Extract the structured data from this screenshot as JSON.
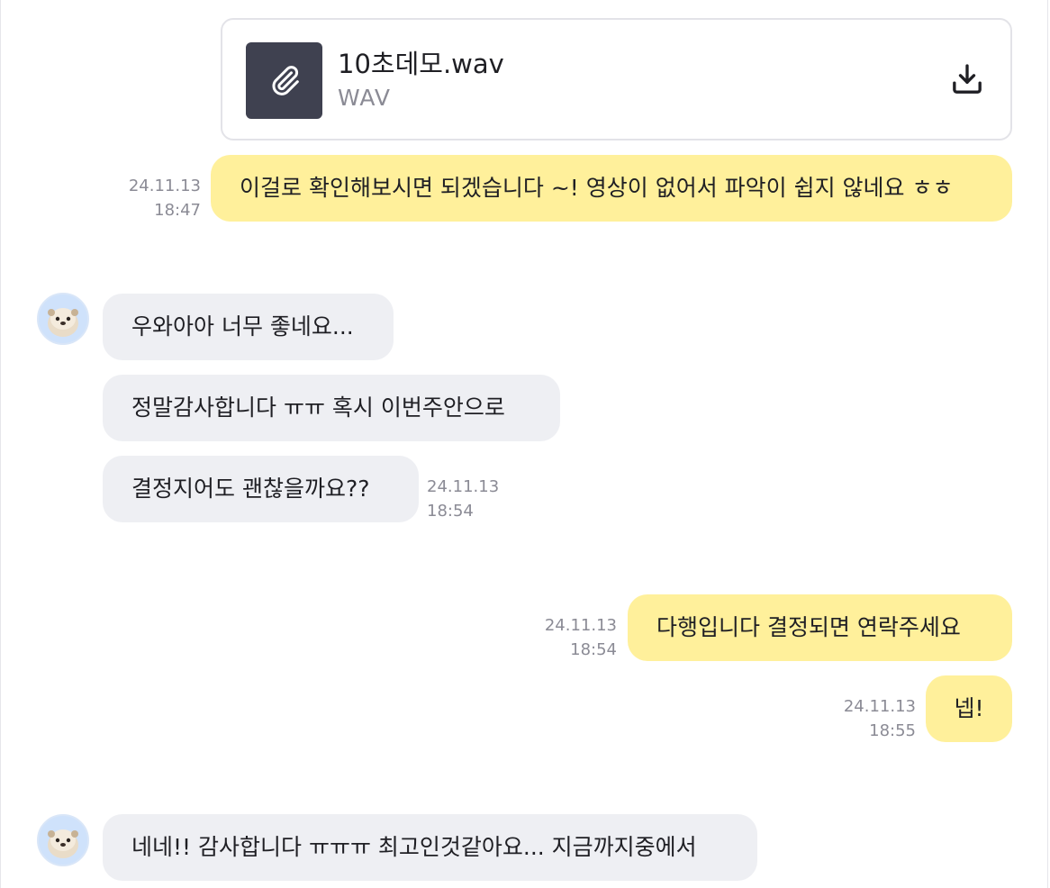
{
  "file": {
    "name": "10초데모.wav",
    "type": "WAV",
    "thumb_icon": "paperclip-icon",
    "download_icon": "download-icon"
  },
  "messages": [
    {
      "side": "out",
      "text": "이걸로 확인해보시면 되겠습니다 ~! 영상이 없어서 파악이 쉽지 않네요 ㅎㅎ",
      "date": "24.11.13",
      "time": "18:47"
    },
    {
      "side": "in",
      "text": "우와아아 너무 좋네요..."
    },
    {
      "side": "in",
      "text": "정말감사합니다 ㅠㅠ 혹시 이번주안으로"
    },
    {
      "side": "in",
      "text": "결정지어도 괜찮을까요??",
      "date": "24.11.13",
      "time": "18:54"
    },
    {
      "side": "out",
      "text": "다행입니다 결정되면 연락주세요",
      "date": "24.11.13",
      "time": "18:54"
    },
    {
      "side": "out",
      "text": "넵!",
      "date": "24.11.13",
      "time": "18:55"
    },
    {
      "side": "in",
      "text": "네네!! 감사합니다 ㅠㅠㅠ 최고인것같아요... 지금까지중에서"
    }
  ],
  "colors": {
    "outgoing_bubble": "#fff09b",
    "incoming_bubble": "#eeeff3",
    "timestamp": "#8b8b95",
    "file_thumb": "#3f4150"
  }
}
